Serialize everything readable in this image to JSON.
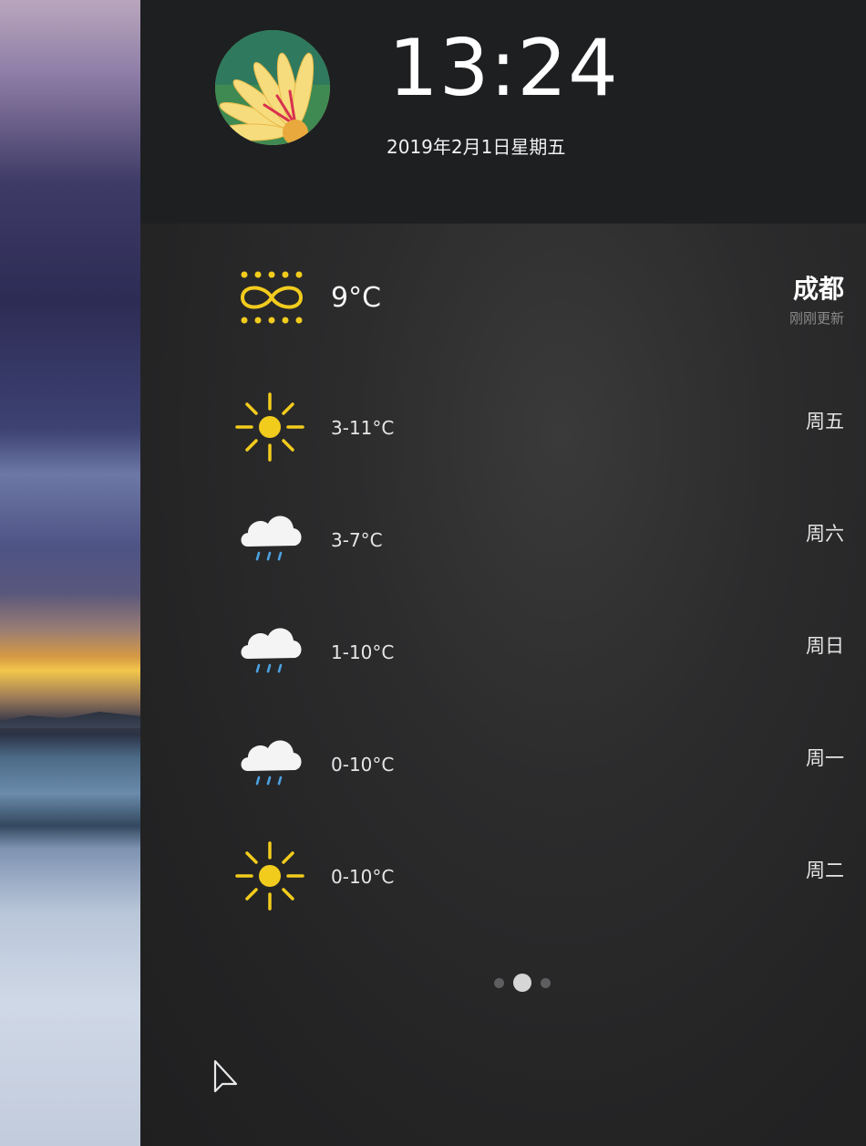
{
  "header": {
    "time": "13:24",
    "date": "2019年2月1日星期五"
  },
  "weather": {
    "current": {
      "icon": "fog-icon",
      "temperature": "9°C",
      "city": "成都",
      "update_status": "刚刚更新"
    },
    "forecast": [
      {
        "icon": "sun-icon",
        "range": "3-11°C",
        "day": "周五"
      },
      {
        "icon": "cloud-rain-icon",
        "range": "3-7°C",
        "day": "周六"
      },
      {
        "icon": "cloud-rain-icon",
        "range": "1-10°C",
        "day": "周日"
      },
      {
        "icon": "cloud-rain-icon",
        "range": "0-10°C",
        "day": "周一"
      },
      {
        "icon": "sun-icon",
        "range": "0-10°C",
        "day": "周二"
      }
    ]
  },
  "pager": {
    "pages": 3,
    "active_page": 2
  },
  "colors": {
    "panel": "#2a2a2b",
    "sun": "#f2cc1d",
    "rain": "#4ca3e2",
    "cloud": "#f4f4f4"
  }
}
